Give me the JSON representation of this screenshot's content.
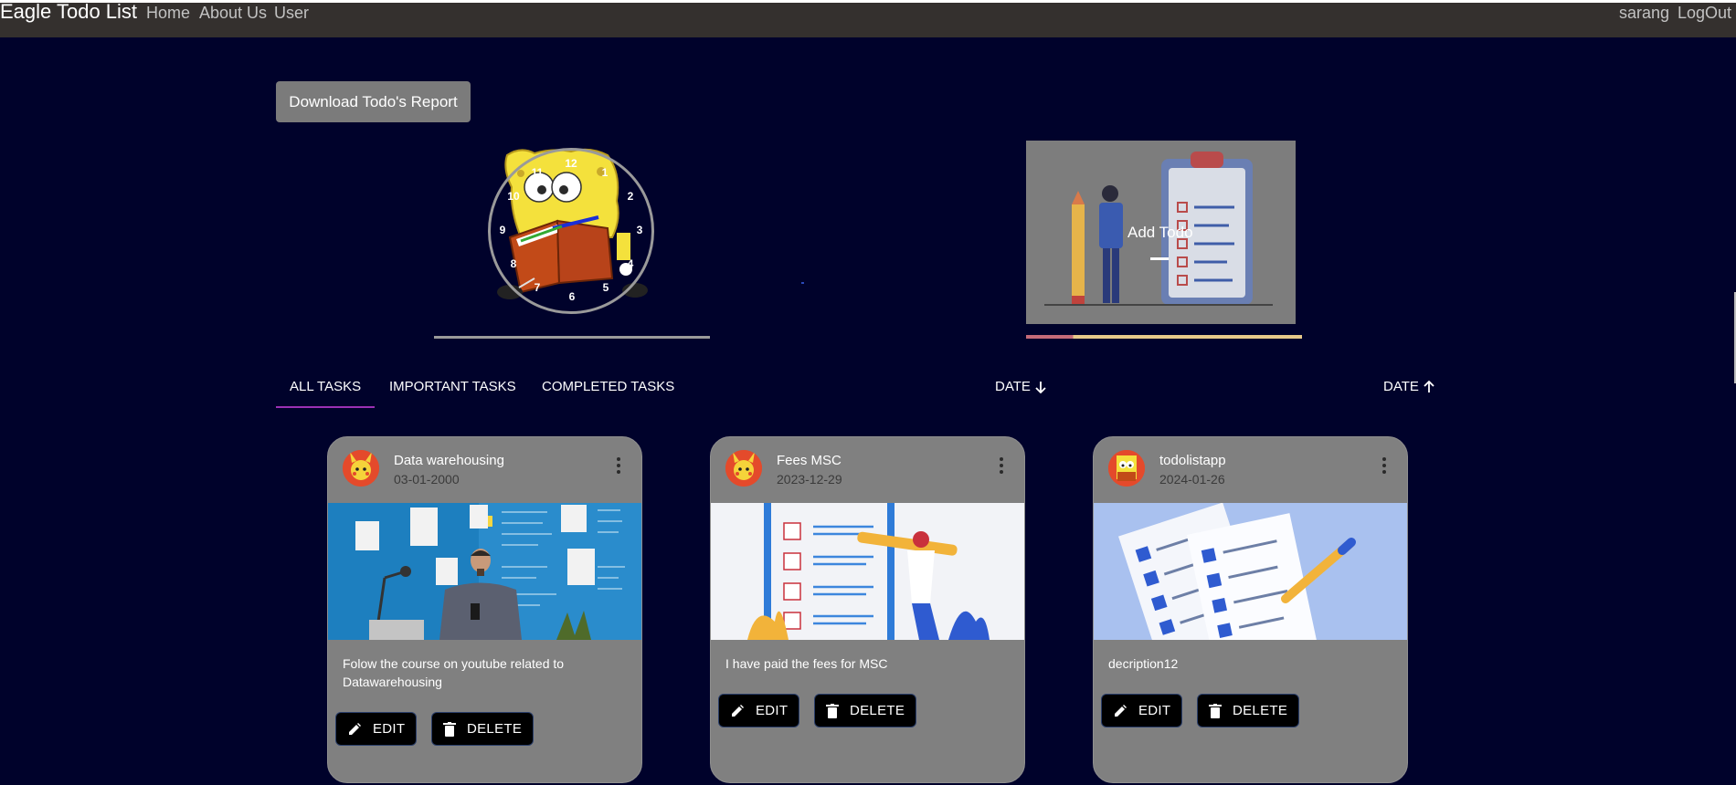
{
  "navbar": {
    "brand": "Eagle Todo List",
    "links": [
      "Home",
      "About Us",
      "User"
    ],
    "user": "sarang",
    "logout": "LogOut"
  },
  "download_label": "Download Todo's Report",
  "clock": {
    "numbers": [
      "12",
      "1",
      "2",
      "3",
      "4",
      "5",
      "6",
      "7",
      "8",
      "9",
      "10",
      "11"
    ]
  },
  "add_todo": {
    "label": "Add Todo"
  },
  "tabs": [
    "ALL TASKS",
    "IMPORTANT TASKS",
    "COMPLETED TASKS"
  ],
  "sort": {
    "desc": "DATE",
    "asc": "DATE"
  },
  "cards": [
    {
      "title": "Data warehousing",
      "date": "03-01-2000",
      "description": "Folow the course on youtube related to Datawarehousing",
      "edit": "EDIT",
      "delete": "DELETE"
    },
    {
      "title": "Fees MSC",
      "date": "2023-12-29",
      "description": "I have paid the fees for MSC",
      "edit": "EDIT",
      "delete": "DELETE"
    },
    {
      "title": "todolistapp",
      "date": "2024-01-26",
      "description": "decription12",
      "edit": "EDIT",
      "delete": "DELETE"
    }
  ],
  "colors": {
    "background": "#00022b",
    "navbar": "#34302e",
    "card": "#808080",
    "tab_underline": "#9b30b4"
  }
}
